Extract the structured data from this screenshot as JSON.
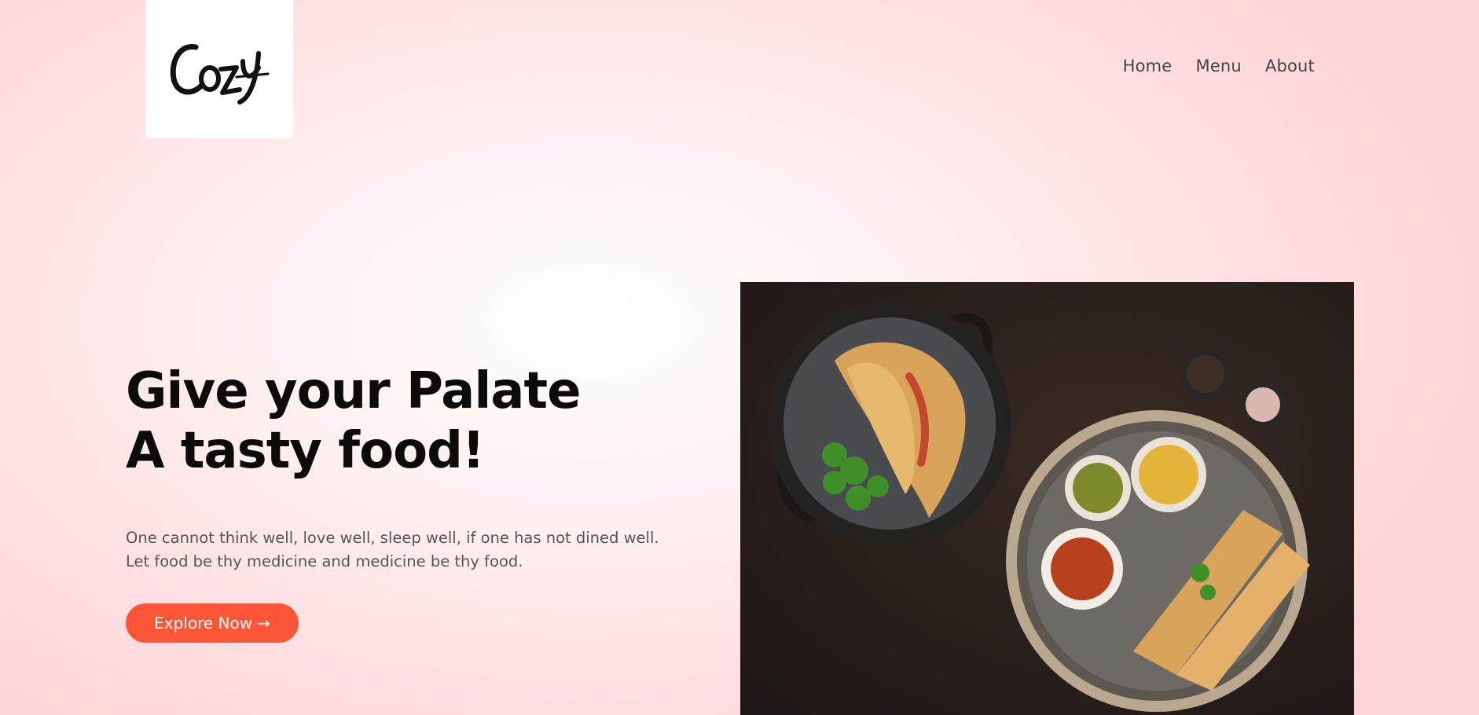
{
  "brand": {
    "logo_text": "Cozy",
    "logo_icon": "cozy-script-logo"
  },
  "nav": {
    "items": [
      {
        "label": "Home"
      },
      {
        "label": "Menu"
      },
      {
        "label": "About"
      }
    ]
  },
  "hero": {
    "headline_line1": "Give your Palate",
    "headline_line2": "A tasty food!",
    "tagline_line1": "One cannot think well, love well, sleep well, if one has not dined well.",
    "tagline_line2": "Let food be thy medicine and medicine be thy food.",
    "cta_label": "Explore Now",
    "cta_icon": "arrow-right-icon",
    "cta_arrow": "→",
    "image": "food-photo-dosa"
  },
  "colors": {
    "accent": "#fd5537",
    "background": "#ffe0e1",
    "text_dark": "#0b0b0b",
    "text_muted": "#555555"
  }
}
